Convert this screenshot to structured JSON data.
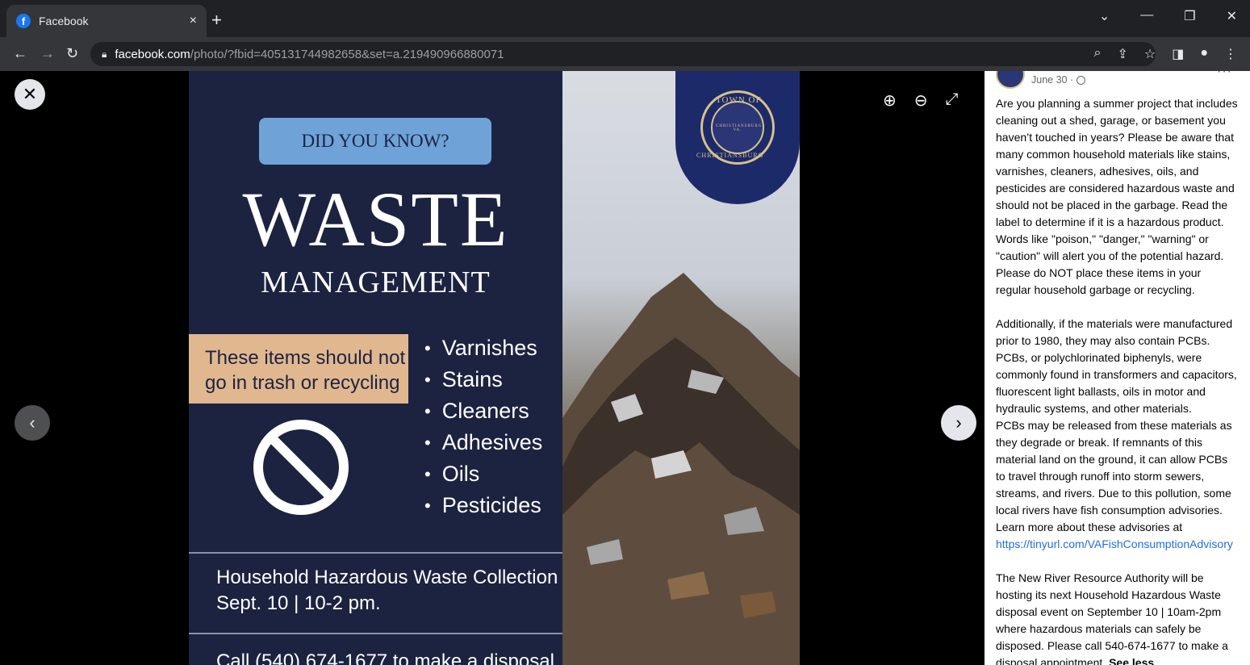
{
  "browser": {
    "tab_title": "Facebook",
    "tab_close": "×",
    "new_tab": "+",
    "url_domain": "facebook.com",
    "url_path": "/photo/?fbid=405131744982658&set=a.219490966880071"
  },
  "poster": {
    "did_you_know": "DID YOU KNOW?",
    "title": "WASTE",
    "subtitle": "MANAGEMENT",
    "items_note_line1": "These items should not",
    "items_note_line2": "go in trash or recycling",
    "items": [
      "Varnishes",
      "Stains",
      "Cleaners",
      "Adhesives",
      "Oils",
      "Pesticides"
    ],
    "collection_line1": "Household Hazardous Waste Collection",
    "collection_line2": "Sept. 10 | 10-2 pm.",
    "call_line": "Call (540) 674-1677 to make a disposal",
    "seal_top": "TOWN OF",
    "seal_bottom": "CHRISTIANSBURG",
    "seal_center": "CHRISTIANSBURG VA."
  },
  "post": {
    "date": "June 30 ·",
    "paragraph1": "Are you planning a summer project that includes cleaning out a shed, garage, or basement you haven’t touched in years? Please be aware that many common household materials like stains, varnishes, cleaners, adhesives, oils, and pesticides are considered hazardous waste and should not be placed in the garbage. Read the label to determine if it is a hazardous product. Words like \"poison,\" \"danger,\" \"warning\" or \"caution\" will alert you of the potential hazard. Please do NOT place these items in your regular household garbage or recycling.",
    "paragraph2": "Additionally, if the materials were manufactured prior to 1980, they may also contain PCBs. PCBs, or polychlorinated biphenyls, were commonly found in transformers and capacitors, fluorescent light ballasts, oils in motor and hydraulic systems, and other materials.",
    "paragraph3": "PCBs may be released from these materials as they degrade or break. If remnants of this material land on the ground, it can allow PCBs to travel through runoff into storm sewers, streams, and rivers. Due to this pollution, some local rivers have fish consumption advisories. Learn more about these advisories at",
    "link": "https://tinyurl.com/VAFishConsumptionAdvisory",
    "paragraph4": "The New River Resource Authority will be hosting its next Household Hazardous Waste disposal event on September 10 | 10am-2pm where hazardous materials can safely be disposed. Please call 540-674-1677 to make a disposal appointment.",
    "see_less": "See less"
  }
}
